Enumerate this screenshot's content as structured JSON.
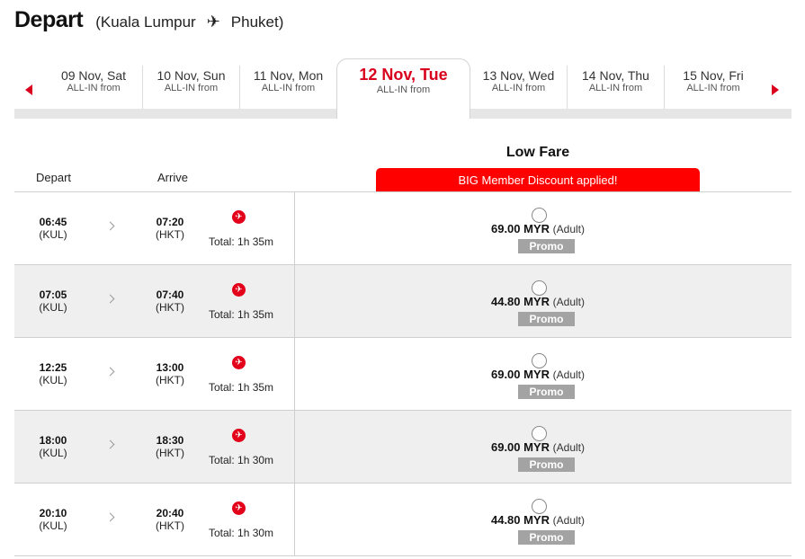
{
  "header": {
    "title": "Depart",
    "route_open": "(",
    "origin": "Kuala Lumpur",
    "destination": "Phuket",
    "route_close": ")"
  },
  "dates": [
    {
      "date": "09 Nov, Sat",
      "sub": "ALL-IN from"
    },
    {
      "date": "10 Nov, Sun",
      "sub": "ALL-IN from"
    },
    {
      "date": "11 Nov, Mon",
      "sub": "ALL-IN from"
    },
    {
      "date": "12 Nov, Tue",
      "sub": "ALL-IN from",
      "active": true
    },
    {
      "date": "13 Nov, Wed",
      "sub": "ALL-IN from"
    },
    {
      "date": "14 Nov, Thu",
      "sub": "ALL-IN from"
    },
    {
      "date": "15 Nov, Fri",
      "sub": "ALL-IN from"
    }
  ],
  "table": {
    "col_depart": "Depart",
    "col_arrive": "Arrive",
    "fare_title": "Low Fare",
    "discount_banner": "BIG Member Discount applied!"
  },
  "flights": [
    {
      "dep_time": "06:45",
      "dep_code": "(KUL)",
      "arr_time": "07:20",
      "arr_code": "(HKT)",
      "total": "Total: 1h 35m",
      "price": "69.00 MYR",
      "pax": "(Adult)",
      "tag": "Promo"
    },
    {
      "dep_time": "07:05",
      "dep_code": "(KUL)",
      "arr_time": "07:40",
      "arr_code": "(HKT)",
      "total": "Total: 1h 35m",
      "price": "44.80 MYR",
      "pax": "(Adult)",
      "tag": "Promo"
    },
    {
      "dep_time": "12:25",
      "dep_code": "(KUL)",
      "arr_time": "13:00",
      "arr_code": "(HKT)",
      "total": "Total: 1h 35m",
      "price": "69.00 MYR",
      "pax": "(Adult)",
      "tag": "Promo"
    },
    {
      "dep_time": "18:00",
      "dep_code": "(KUL)",
      "arr_time": "18:30",
      "arr_code": "(HKT)",
      "total": "Total: 1h 30m",
      "price": "69.00 MYR",
      "pax": "(Adult)",
      "tag": "Promo"
    },
    {
      "dep_time": "20:10",
      "dep_code": "(KUL)",
      "arr_time": "20:40",
      "arr_code": "(HKT)",
      "total": "Total: 1h 30m",
      "price": "44.80 MYR",
      "pax": "(Adult)",
      "tag": "Promo"
    }
  ],
  "colors": {
    "accent": "#d8001c",
    "banner": "#ff0000",
    "promo": "#a3a3a3",
    "alt_row": "#efefef"
  },
  "icons": {
    "route": "airplane-icon",
    "prev": "caret-left-icon",
    "next": "caret-right-icon",
    "flight": "flight-details-icon"
  }
}
